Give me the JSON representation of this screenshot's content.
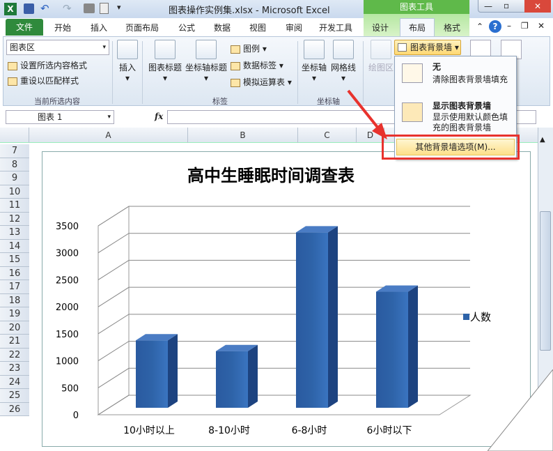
{
  "window": {
    "title": "图表操作实例集.xlsx - Microsoft Excel",
    "context_group": "图表工具"
  },
  "tabs": [
    "文件",
    "开始",
    "插入",
    "页面布局",
    "公式",
    "数据",
    "视图",
    "审阅",
    "开发工具",
    "设计",
    "布局",
    "格式"
  ],
  "active_tab": "布局",
  "ribbon": {
    "selection_dropdown": "图表区",
    "format_selection": "设置所选内容格式",
    "reset_style": "重设以匹配样式",
    "group_current": "当前所选内容",
    "insert": "插入",
    "chart_title": "图表标题",
    "axis_title": "坐标轴标题",
    "legend": "图例",
    "data_labels": "数据标签",
    "data_table": "模拟运算表",
    "group_labels": "标签",
    "axes": "坐标轴",
    "gridlines": "网格线",
    "group_axes": "坐标轴",
    "plot_area": "绘图区",
    "chart_wall": "图表背景墙"
  },
  "menu": {
    "items": [
      {
        "title": "无",
        "desc": "清除图表背景墙填充"
      },
      {
        "title": "显示图表背景墙",
        "desc": "显示使用默认颜色填充的图表背景墙"
      }
    ],
    "more": "其他背景墙选项(M)..."
  },
  "namebox": "图表 1",
  "fx": "fx",
  "columns": [
    "A",
    "B",
    "C",
    "D"
  ],
  "rows": [
    "7",
    "8",
    "9",
    "10",
    "11",
    "12",
    "13",
    "14",
    "15",
    "16",
    "17",
    "18",
    "19",
    "20",
    "21",
    "22",
    "23",
    "24",
    "25",
    "26"
  ],
  "colors": {
    "bar": "#2e63a8",
    "highlight": "#e8322d"
  },
  "chart_data": {
    "type": "bar",
    "title": "高中生睡眠时间调查表",
    "categories": [
      "10小时以上",
      "8-10小时",
      "6-8小时",
      "6小时以下"
    ],
    "series": [
      {
        "name": "人数",
        "values": [
          1250,
          1050,
          3250,
          2150
        ]
      }
    ],
    "yticks": [
      "0",
      "500",
      "1000",
      "1500",
      "2000",
      "2500",
      "3000",
      "3500"
    ],
    "ylim": [
      0,
      3500
    ],
    "grid": true,
    "legend": "right",
    "style": "3d-column"
  }
}
